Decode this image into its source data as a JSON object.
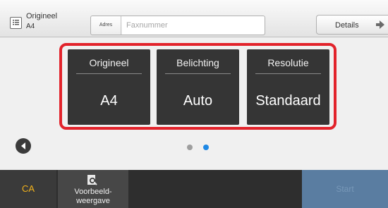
{
  "header": {
    "original_label": "Origineel",
    "original_size": "A4",
    "address_button": "Adres",
    "fax_placeholder": "Faxnummer",
    "details_button": "Details"
  },
  "settings": [
    {
      "title": "Origineel",
      "value": "A4"
    },
    {
      "title": "Belichting",
      "value": "Auto"
    },
    {
      "title": "Resolutie",
      "value": "Standaard"
    }
  ],
  "pager": {
    "page_count": 2,
    "active_page": 2
  },
  "footer": {
    "ca_button": "CA",
    "preview_line1": "Voorbeeld-",
    "preview_line2": "weergave",
    "start_button": "Start"
  },
  "colors": {
    "highlight": "#e2232b",
    "tile": "#353535",
    "ca_text": "#f2b21b",
    "dot_active": "#1e88e5",
    "dot_inactive": "#9e9e9e",
    "start_disabled": "#5a7da1"
  },
  "icons": [
    "original-document-icon",
    "arrow-right-icon",
    "back-arrow-icon",
    "preview-magnifier-icon"
  ]
}
